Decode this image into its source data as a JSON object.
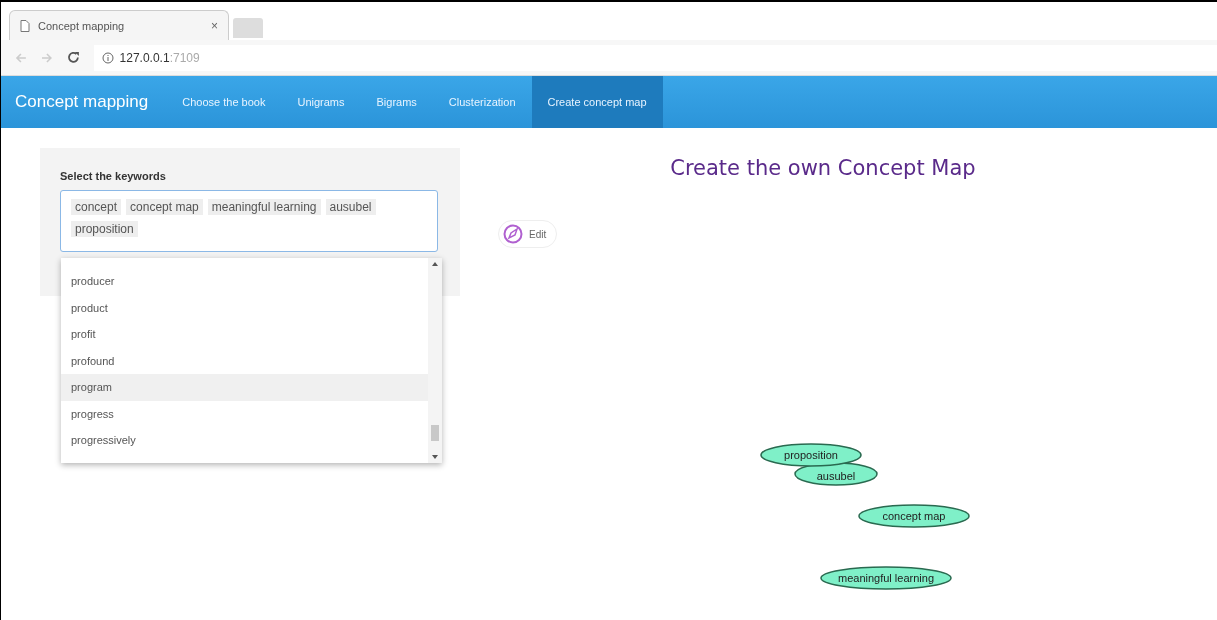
{
  "browser": {
    "tab_title": "Concept mapping",
    "tab_close": "×",
    "url_host": "127.0.0.1",
    "url_port": ":7109"
  },
  "navbar": {
    "brand": "Concept mapping",
    "items": [
      {
        "label": "Choose the book",
        "selected": false
      },
      {
        "label": "Unigrams",
        "selected": false
      },
      {
        "label": "Bigrams",
        "selected": false
      },
      {
        "label": "Clusterization",
        "selected": false
      },
      {
        "label": "Create concept map",
        "selected": true
      }
    ]
  },
  "keywords": {
    "label": "Select the keywords",
    "tags": [
      "concept",
      "concept map",
      "meaningful learning",
      "ausubel",
      "proposition"
    ],
    "options": [
      {
        "label": "producer",
        "selected": false
      },
      {
        "label": "product",
        "selected": false
      },
      {
        "label": "profit",
        "selected": false
      },
      {
        "label": "profound",
        "selected": false
      },
      {
        "label": "program",
        "selected": true
      },
      {
        "label": "progress",
        "selected": false
      },
      {
        "label": "progressively",
        "selected": false
      }
    ]
  },
  "edit_button": {
    "label": "Edit"
  },
  "map": {
    "title": "Create the own Concept Map",
    "nodes": [
      "proposition",
      "ausubel",
      "concept map",
      "meaningful learning"
    ]
  }
}
